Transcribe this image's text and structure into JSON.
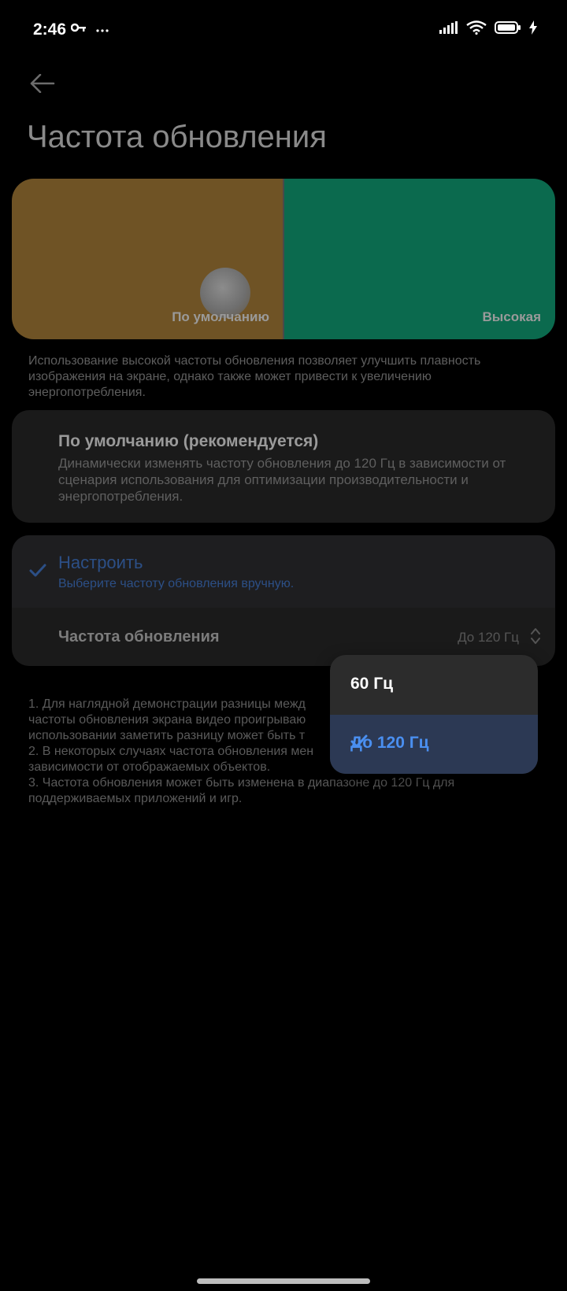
{
  "status": {
    "time": "2:46",
    "left_icons": [
      "key-icon",
      "more-dots-icon"
    ],
    "right_icons": [
      "signal-icon",
      "wifi-icon",
      "battery-icon",
      "charging-icon"
    ]
  },
  "header": {
    "title": "Частота обновления"
  },
  "preview": {
    "left_label": "По умолчанию",
    "right_label": "Высокая"
  },
  "description": "Использование высокой частоты обновления позволяет улучшить плавность изображения на экране, однако также может привести к увеличению энергопотребления.",
  "options": {
    "default": {
      "title": "По умолчанию (рекомендуется)",
      "subtitle": "Динамически изменять частоту обновления до 120 Гц в зависимости от сценария использования для оптимизации производительности и энергопотребления."
    },
    "custom": {
      "title": "Настроить",
      "subtitle": "Выберите частоту обновления вручную.",
      "rate_label": "Частота обновления",
      "rate_value": "До 120 Гц"
    }
  },
  "notes": [
    "1. Для наглядной демонстрации разницы межд",
    "частоты обновления экрана видео проигрываю",
    "использовании заметить разницу может быть т",
    "2. В некоторых случаях частота обновления мен",
    "зависимости от отображаемых объектов.",
    "3. Частота обновления может быть изменена в диапазоне до 120 Гц для",
    "поддерживаемых приложений и игр."
  ],
  "dropdown": {
    "options": [
      "60 Гц",
      "До 120 Гц"
    ],
    "selected": "До 120 Гц"
  },
  "colors": {
    "accent": "#4a8ff0",
    "preview_default": "#6f5325",
    "preview_high": "#0b6a4e"
  }
}
